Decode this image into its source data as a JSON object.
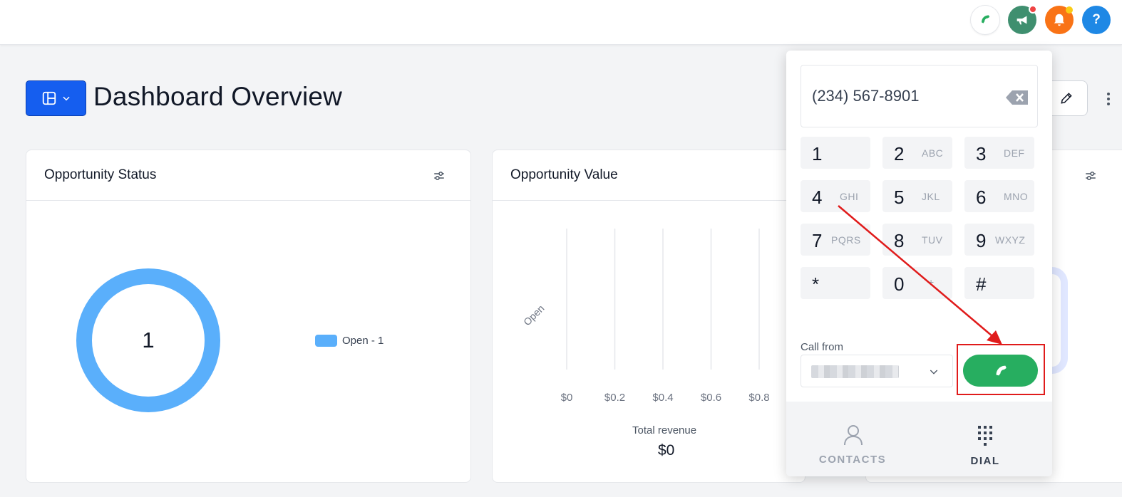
{
  "header": {
    "phone_icon": "phone-icon",
    "announce_icon": "megaphone-icon",
    "bell_icon": "bell-icon",
    "help_label": "?"
  },
  "page": {
    "title": "Dashboard Overview"
  },
  "cards": {
    "status": {
      "title": "Opportunity Status",
      "center_value": "1",
      "legend": "Open - 1"
    },
    "value": {
      "title": "Opportunity Value",
      "category": "Open",
      "total_label": "Total revenue",
      "total_value": "$0"
    }
  },
  "chart_data": {
    "type": "bar",
    "title": "Opportunity Value",
    "categories": [
      "Open"
    ],
    "values": [
      0
    ],
    "x_ticks": [
      "$0",
      "$0.2",
      "$0.4",
      "$0.6",
      "$0.8"
    ],
    "xlim": [
      0,
      1
    ],
    "orientation": "horizontal",
    "grid": true
  },
  "dialer": {
    "number": "(234) 567-8901",
    "keys": [
      {
        "digit": "1",
        "letters": ""
      },
      {
        "digit": "2",
        "letters": "ABC"
      },
      {
        "digit": "3",
        "letters": "DEF"
      },
      {
        "digit": "4",
        "letters": "GHI"
      },
      {
        "digit": "5",
        "letters": "JKL"
      },
      {
        "digit": "6",
        "letters": "MNO"
      },
      {
        "digit": "7",
        "letters": "PQRS"
      },
      {
        "digit": "8",
        "letters": "TUV"
      },
      {
        "digit": "9",
        "letters": "WXYZ"
      },
      {
        "digit": "*",
        "letters": ""
      },
      {
        "digit": "0",
        "letters": "+"
      },
      {
        "digit": "#",
        "letters": ""
      }
    ],
    "call_from_label": "Call from",
    "tabs": {
      "contacts": "CONTACTS",
      "dial": "DIAL"
    }
  },
  "colors": {
    "primary": "#155eef",
    "donut": "#5aaffb",
    "call": "#27ae60",
    "annotation": "#e01b1b"
  }
}
